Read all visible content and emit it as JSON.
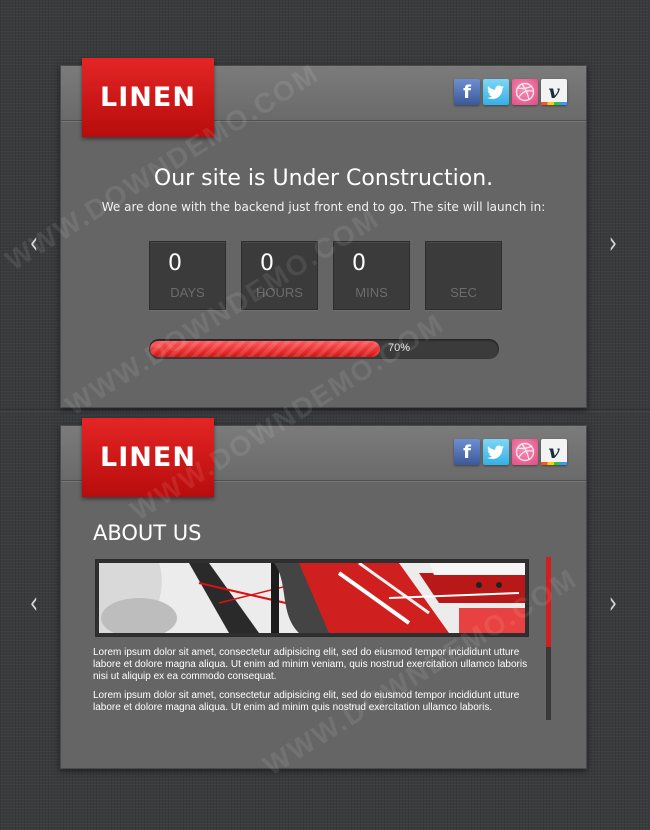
{
  "brand": {
    "logo_text": "LINEN",
    "accent": "#d41414"
  },
  "social": [
    {
      "name": "facebook",
      "glyph": "f"
    },
    {
      "name": "twitter",
      "glyph": ""
    },
    {
      "name": "dribbble",
      "glyph": ""
    },
    {
      "name": "vimeo",
      "glyph": "v"
    }
  ],
  "construction": {
    "headline": "Our site is Under Construction.",
    "subline": "We are done with the backend just front end to go. The site will launch in:",
    "countdown": [
      {
        "value": "0",
        "label": "DAYS"
      },
      {
        "value": "0",
        "label": "HOURS"
      },
      {
        "value": "0",
        "label": "MINS"
      },
      {
        "value": "",
        "label": "SEC"
      }
    ],
    "progress": {
      "fraction": 0.7,
      "label": "70%"
    }
  },
  "about": {
    "title": "ABOUT US",
    "paragraphs": [
      "Lorem ipsum dolor sit amet, consectetur adipisicing elit, sed do eiusmod tempor incididunt utture labore et dolore magna aliqua. Ut enim ad minim veniam, quis nostrud exercitation ullamco laboris nisi ut aliquip ex ea commodo consequat.",
      "Lorem ipsum dolor sit amet, consectetur adipisicing elit, sed do eiusmod tempor incididunt utture labore et dolore magna aliqua. Ut enim ad minim quis nostrud exercitation ullamco laboris."
    ]
  },
  "nav": {
    "prev_glyph": "‹",
    "next_glyph": "›"
  },
  "watermark": {
    "text": "WWW.DOWNDEMO.COM"
  }
}
